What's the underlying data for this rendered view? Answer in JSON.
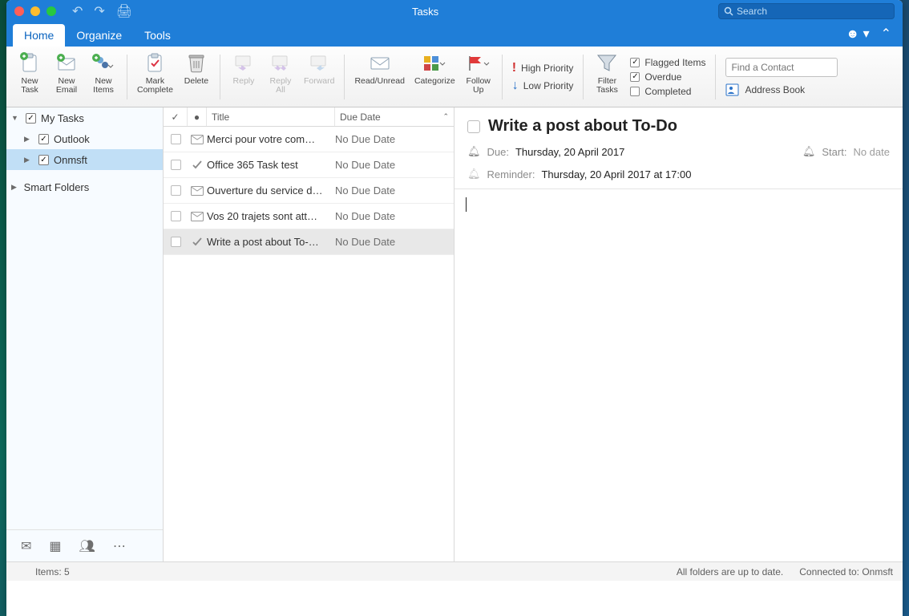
{
  "title": "Tasks",
  "search_placeholder": "Search",
  "tabs": [
    "Home",
    "Organize",
    "Tools"
  ],
  "ribbon": {
    "new_task": "New\nTask",
    "new_email": "New\nEmail",
    "new_items": "New\nItems",
    "mark_complete": "Mark\nComplete",
    "delete": "Delete",
    "reply": "Reply",
    "reply_all": "Reply\nAll",
    "forward": "Forward",
    "read_unread": "Read/Unread",
    "categorize": "Categorize",
    "follow_up": "Follow\nUp",
    "high_priority": "High Priority",
    "low_priority": "Low Priority",
    "filter_tasks": "Filter\nTasks",
    "flagged_items": "Flagged Items",
    "overdue": "Overdue",
    "completed": "Completed",
    "find_contact_placeholder": "Find a Contact",
    "address_book": "Address Book"
  },
  "sidebar": {
    "my_tasks": "My Tasks",
    "outlook": "Outlook",
    "onmsft": "Onmsft",
    "smart_folders": "Smart Folders"
  },
  "list": {
    "col_title": "Title",
    "col_due": "Due Date",
    "rows": [
      {
        "title": "Merci pour votre com…",
        "due": "No Due Date",
        "icon": "mail"
      },
      {
        "title": "Office 365 Task test",
        "due": "No Due Date",
        "icon": "check"
      },
      {
        "title": "Ouverture du service d…",
        "due": "No Due Date",
        "icon": "mail"
      },
      {
        "title": "Vos 20 trajets sont att…",
        "due": "No Due Date",
        "icon": "mail"
      },
      {
        "title": "Write a post about To-…",
        "due": "No Due Date",
        "icon": "check"
      }
    ]
  },
  "detail": {
    "title": "Write a post about To-Do",
    "due_label": "Due:",
    "due_value": "Thursday, 20 April 2017",
    "start_label": "Start:",
    "start_value": "No date",
    "reminder_label": "Reminder:",
    "reminder_value": "Thursday, 20 April 2017 at 17:00"
  },
  "status": {
    "items": "Items: 5",
    "folders": "All folders are up to date.",
    "connected": "Connected to: Onmsft"
  }
}
